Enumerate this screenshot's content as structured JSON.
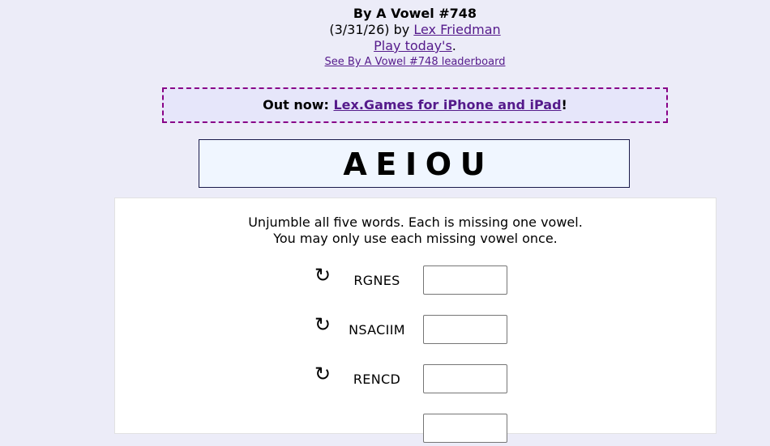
{
  "header": {
    "title": "By A Vowel #748",
    "date_prefix": "(3/31/26) by ",
    "author": "Lex Friedman",
    "play_today": "Play today's",
    "play_today_suffix": ".",
    "leaderboard": "See By A Vowel #748 leaderboard"
  },
  "promo": {
    "prefix": "Out now: ",
    "link": "Lex.Games for iPhone and iPad",
    "suffix": "!"
  },
  "vowels": "AEIOU",
  "instructions": {
    "line1": "Unjumble all five words. Each is missing one vowel.",
    "line2": "You may only use each missing vowel once."
  },
  "puzzles": [
    {
      "letters": "RGNES",
      "value": ""
    },
    {
      "letters": "NSACIIM",
      "value": ""
    },
    {
      "letters": "RENCD",
      "value": ""
    },
    {
      "letters": "",
      "value": ""
    }
  ],
  "icons": {
    "shuffle": "↻"
  }
}
